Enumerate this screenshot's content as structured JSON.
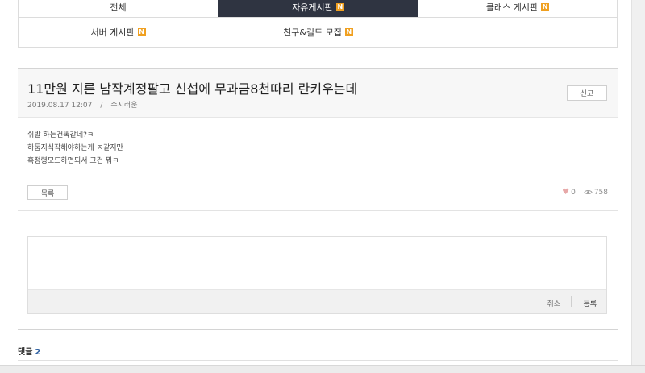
{
  "categories": {
    "row1": [
      {
        "label": "전체",
        "new": false,
        "active": false
      },
      {
        "label": "자유게시판",
        "new": true,
        "active": true
      },
      {
        "label": "클래스 게시판",
        "new": true,
        "active": false
      }
    ],
    "row2": [
      {
        "label": "서버 게시판",
        "new": true,
        "active": false
      },
      {
        "label": "친구&길드 모집",
        "new": true,
        "active": false
      },
      {
        "label": "",
        "new": false,
        "active": false
      }
    ],
    "badge": "N"
  },
  "post": {
    "title": "11만원 지른 남작계정팔고 신섭에 무과금8천따리 란키우는데",
    "date": "2019.08.17 12:07",
    "separator": "/",
    "author": "수시러운",
    "report_label": "신고",
    "body_lines": [
      "쉬발 하는건똑같네?ㅋ",
      "하둠지식작해야하는게 ㅈ같지만",
      "흑정령모드하면되서 그건 뭐ㅋ"
    ],
    "list_label": "목록",
    "likes": "0",
    "views": "758"
  },
  "comment_form": {
    "placeholder": "",
    "cancel_label": "취소",
    "submit_label": "등록"
  },
  "comments": {
    "label": "댓글",
    "count": "2"
  },
  "colors": {
    "active_tab_bg": "#2f3441",
    "badge": "#f0a020",
    "comment_count": "#2a5d9f"
  }
}
